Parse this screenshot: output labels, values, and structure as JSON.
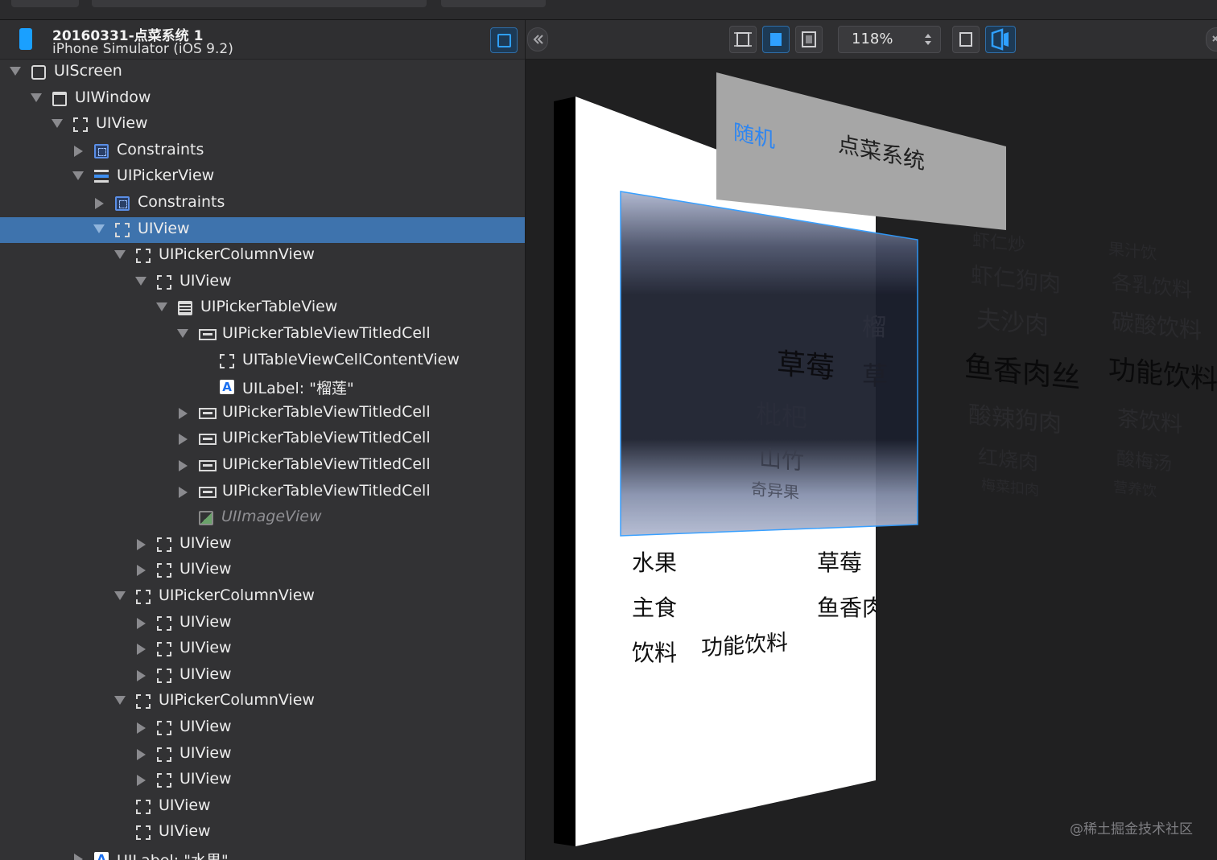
{
  "process": {
    "title": "20160331-点菜系统 1",
    "subtitle": "iPhone Simulator (iOS 9.2)"
  },
  "toolbar": {
    "zoom_value": "118%"
  },
  "tree": [
    {
      "label": "UIScreen",
      "icon": "screen-icon",
      "disclosure": "down",
      "depth": 0
    },
    {
      "label": "UIWindow",
      "icon": "window-icon",
      "disclosure": "down",
      "depth": 1
    },
    {
      "label": "UIView",
      "icon": "view-icon",
      "disclosure": "down",
      "depth": 2
    },
    {
      "label": "Constraints",
      "icon": "constraints-icon",
      "disclosure": "right",
      "depth": 3
    },
    {
      "label": "UIPickerView",
      "icon": "picker-icon",
      "disclosure": "down",
      "depth": 3
    },
    {
      "label": "Constraints",
      "icon": "constraints-icon",
      "disclosure": "right",
      "depth": 4
    },
    {
      "label": "UIView",
      "icon": "view-icon",
      "disclosure": "down",
      "depth": 4,
      "selected": true
    },
    {
      "label": "UIPickerColumnView",
      "icon": "view-icon",
      "disclosure": "down",
      "depth": 5
    },
    {
      "label": "UIView",
      "icon": "view-icon",
      "disclosure": "down",
      "depth": 6
    },
    {
      "label": "UIPickerTableView",
      "icon": "table-icon",
      "disclosure": "down",
      "depth": 7
    },
    {
      "label": "UIPickerTableViewTitledCell",
      "icon": "cell-icon",
      "disclosure": "down",
      "depth": 8
    },
    {
      "label": "UITableViewCellContentView",
      "icon": "view-icon",
      "disclosure": "none",
      "depth": 9
    },
    {
      "label": "UILabel: \"榴莲\"",
      "icon": "label-icon",
      "disclosure": "none",
      "depth": 9
    },
    {
      "label": "UIPickerTableViewTitledCell",
      "icon": "cell-icon",
      "disclosure": "right",
      "depth": 8
    },
    {
      "label": "UIPickerTableViewTitledCell",
      "icon": "cell-icon",
      "disclosure": "right",
      "depth": 8
    },
    {
      "label": "UIPickerTableViewTitledCell",
      "icon": "cell-icon",
      "disclosure": "right",
      "depth": 8
    },
    {
      "label": "UIPickerTableViewTitledCell",
      "icon": "cell-icon",
      "disclosure": "right",
      "depth": 8
    },
    {
      "label": "UIImageView",
      "icon": "image-icon",
      "disclosure": "none",
      "depth": 8,
      "dim": true
    },
    {
      "label": "UIView",
      "icon": "view-icon",
      "disclosure": "right",
      "depth": 6
    },
    {
      "label": "UIView",
      "icon": "view-icon",
      "disclosure": "right",
      "depth": 6
    },
    {
      "label": "UIPickerColumnView",
      "icon": "view-icon",
      "disclosure": "down",
      "depth": 5
    },
    {
      "label": "UIView",
      "icon": "view-icon",
      "disclosure": "right",
      "depth": 6
    },
    {
      "label": "UIView",
      "icon": "view-icon",
      "disclosure": "right",
      "depth": 6
    },
    {
      "label": "UIView",
      "icon": "view-icon",
      "disclosure": "right",
      "depth": 6
    },
    {
      "label": "UIPickerColumnView",
      "icon": "view-icon",
      "disclosure": "down",
      "depth": 5
    },
    {
      "label": "UIView",
      "icon": "view-icon",
      "disclosure": "right",
      "depth": 6
    },
    {
      "label": "UIView",
      "icon": "view-icon",
      "disclosure": "right",
      "depth": 6
    },
    {
      "label": "UIView",
      "icon": "view-icon",
      "disclosure": "right",
      "depth": 6
    },
    {
      "label": "UIView",
      "icon": "view-icon",
      "disclosure": "none",
      "depth": 5
    },
    {
      "label": "UIView",
      "icon": "view-icon",
      "disclosure": "none",
      "depth": 5
    },
    {
      "label": "UILabel: \"水果\"",
      "icon": "label-icon",
      "disclosure": "right",
      "depth": 3
    }
  ],
  "canvas": {
    "nav_left": "随机",
    "nav_title": "点菜系统",
    "picker_col1": [
      "草莓",
      "枇杷",
      "山竹",
      "奇异果"
    ],
    "picker_col1_peek": [
      "榴",
      "草"
    ],
    "picker_col2": [
      "虾仁炒",
      "虾仁狗肉",
      "夫沙肉",
      "鱼香肉丝",
      "酸辣狗肉",
      "红烧肉",
      "梅菜扣肉"
    ],
    "picker_col3": [
      "果汁饮",
      "各乳饮料",
      "碳酸饮料",
      "功能饮料",
      "茶饮料",
      "酸梅汤",
      "营养饮"
    ],
    "labels_left": [
      "水果",
      "主食",
      "饮料"
    ],
    "labels_right": [
      "草莓",
      "鱼香肉丝"
    ],
    "label_mid": "功能饮料",
    "watermark": "@稀土掘金技术社区"
  },
  "colors": {
    "selection": "#3e73ad",
    "accent_blue": "#2fa0ff",
    "panel_bg": "#323234",
    "canvas_bg": "#202021"
  }
}
